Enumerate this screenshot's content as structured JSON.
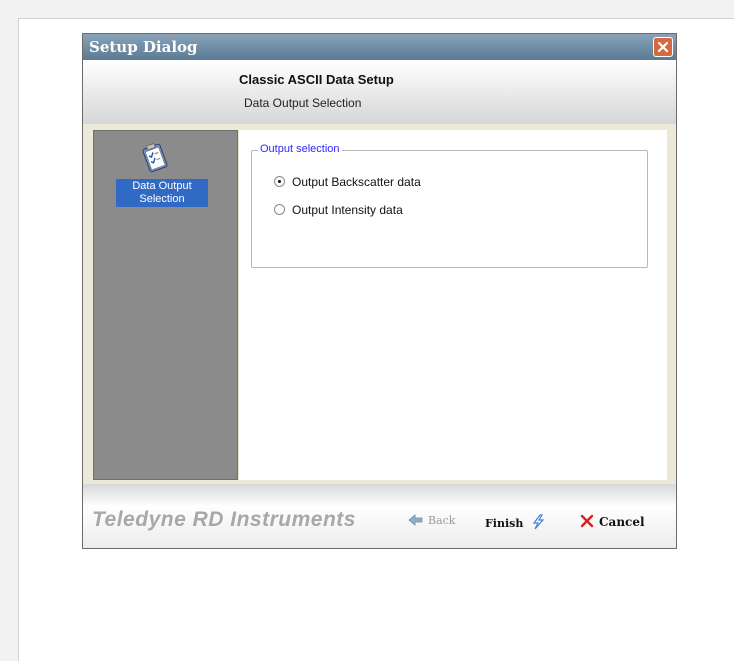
{
  "window": {
    "title": "Setup Dialog"
  },
  "header": {
    "heading": "Classic ASCII Data Setup",
    "subheading": "Data Output Selection"
  },
  "sidebar": {
    "items": [
      {
        "label": "Data Output Selection",
        "icon": "clipboard-checklist-icon",
        "selected": true
      }
    ]
  },
  "output_selection": {
    "legend": "Output selection",
    "options": [
      {
        "label": "Output Backscatter data",
        "checked": true
      },
      {
        "label": "Output Intensity data",
        "checked": false
      }
    ]
  },
  "footer": {
    "brand": "Teledyne RD Instruments",
    "back_label": "Back",
    "finish_label": "Finish",
    "cancel_label": "Cancel"
  },
  "colors": {
    "selection": "#316ac5",
    "legend_text": "#2a2aff",
    "close_button": "#d56a42",
    "sidebar": "#8b8b8b"
  }
}
